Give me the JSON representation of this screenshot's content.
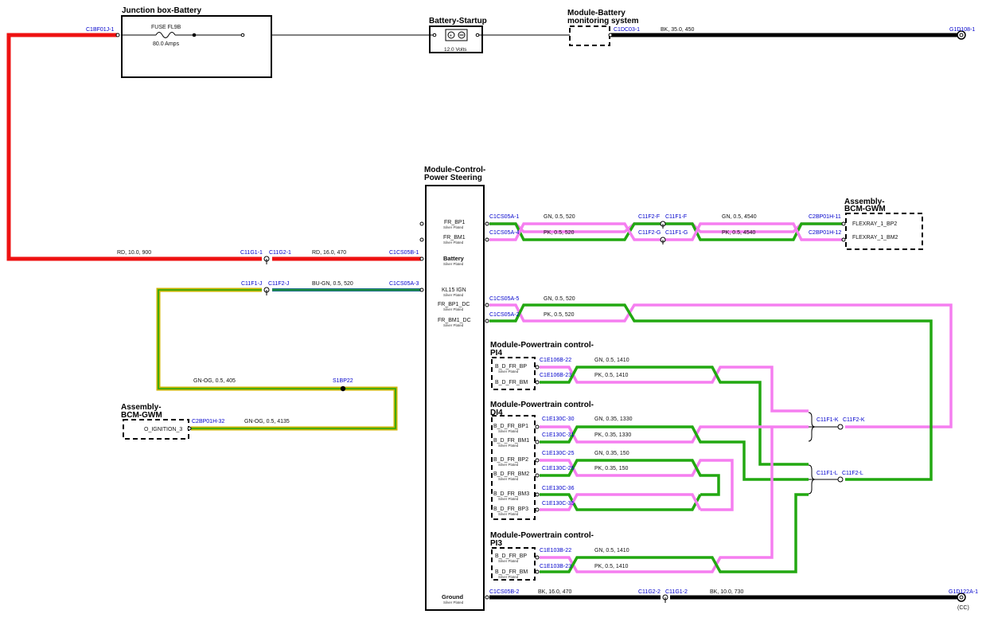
{
  "components": {
    "junction_box_battery": "Junction box-Battery",
    "fuse_label": "FUSE FL9B",
    "fuse_rating": "80.0 Amps",
    "battery_startup": "Battery-Startup",
    "battery_volts": "12.0 Volts",
    "module_battery_monitoring_1": "Module-Battery",
    "module_battery_monitoring_2": "monitoring system",
    "power_steering_1": "Module-Control-",
    "power_steering_2": "Power Steering",
    "bcm_gwm_right_1": "Assembly-",
    "bcm_gwm_right_2": "BCM-GWM",
    "bcm_gwm_left_1": "Assembly-",
    "bcm_gwm_left_2": "BCM-GWM",
    "pt_pi4_1": "Module-Powertrain control-",
    "pt_pi4_2": "PI4",
    "pt_di4_1": "Module-Powertrain control-",
    "pt_di4_2": "DI4",
    "pt_pi3_1": "Module-Powertrain control-",
    "pt_pi3_2": "PI3"
  },
  "connectors": {
    "c1bf01j_1": "C1BF01J-1",
    "c1dc03_1": "C1DC03-1",
    "g1d108_1": "G1D108-1",
    "c1cs05a_1": "C1CS05A-1",
    "c1cs05a_4": "C1CS05A-4",
    "c11f2_f": "C11F2-F",
    "c11f1_f": "C11F1-F",
    "c11f2_g": "C11F2-G",
    "c11f1_g": "C11F1-G",
    "c2bp01h_11": "C2BP01H-11",
    "c2bp01h_12": "C2BP01H-12",
    "c11g1_1": "C11G1-1",
    "c11g2_1": "C11G2-1",
    "c1cs05b_1": "C1CS05B-1",
    "c11f1_j": "C11F1-J",
    "c11f2_j": "C11F2-J",
    "c1cs05a_3": "C1CS05A-3",
    "c1cs05a_5": "C1CS05A-5",
    "c1cs05a_2": "C1CS05A-2",
    "c1e106b_22": "C1E106B-22",
    "c1e106b_23": "C1E106B-23",
    "s1bp22": "S1BP22",
    "c2bp01h_32": "C2BP01H-32",
    "c11f1_k": "C11F1-K",
    "c11f2_k": "C11F2-K",
    "c11f1_l": "C11F1-L",
    "c11f2_l": "C11F2-L",
    "c1e130c_30": "C1E130C-30",
    "c1e130c_31": "C1E130C-31",
    "c1e130c_25": "C1E130C-25",
    "c1e130c_26": "C1E130C-26",
    "c1e130c_36": "C1E130C-36",
    "c1e130c_35": "C1E130C-35",
    "c1e103b_22": "C1E103B-22",
    "c1e103b_23": "C1E103B-23",
    "c1cs05b_2": "C1CS05B-2",
    "c11g2_2": "C11G2-2",
    "c11g1_2": "C11G1-2",
    "g1d122a_1": "G1D122A-1",
    "cc": "(CC)"
  },
  "wires": {
    "bk_35_450": "BK, 35.0, 450",
    "gn_05_520_a": "GN, 0.5, 520",
    "gn_05_4540": "GN, 0.5, 4540",
    "pk_05_520_a": "PK, 0.5, 520",
    "pk_05_4540": "PK, 0.5, 4540",
    "rd_10_900": "RD, 10.0, 900",
    "rd_16_470": "RD, 16.0, 470",
    "bu_gn_05_520": "BU-GN, 0.5, 520",
    "gn_05_520_b": "GN, 0.5, 520",
    "pk_05_520_b": "PK, 0.5, 520",
    "gn_og_05_405": "GN-OG, 0.5, 405",
    "gn_og_05_4135": "GN-OG, 0.5, 4135",
    "gn_05_1410_a": "GN, 0.5, 1410",
    "pk_05_1410_a": "PK, 0.5, 1410",
    "gn_035_1330": "GN, 0.35, 1330",
    "pk_035_1330": "PK, 0.35, 1330",
    "gn_035_150": "GN, 0.35, 150",
    "pk_035_150": "PK, 0.35, 150",
    "gn_05_1410_b": "GN, 0.5, 1410",
    "pk_05_1410_b": "PK, 0.5, 1410",
    "bk_16_470": "BK, 16.0, 470",
    "bk_10_730": "BK, 10.0, 730"
  },
  "pins": {
    "ps_fr_bp1": "FR_BP1",
    "ps_fr_bm1": "FR_BM1",
    "ps_battery": "Battery",
    "ps_kl15": "KL15 IGN",
    "ps_fr_bp1_dc": "FR_BP1_DC",
    "ps_fr_bm1_dc": "FR_BM1_DC",
    "ps_ground": "Ground",
    "silver_plated": "Silver Plated",
    "flexray_bp2": "FLEXRAY_1_BP2",
    "flexray_bm2": "FLEXRAY_1_BM2",
    "o_ignition_3": "O_IGNITION_3",
    "b_d_fr_bp": "B_D_FR_BP",
    "b_d_fr_bm": "B_D_FR_BM",
    "b_d_fr_bp1": "B_D_FR_BP1",
    "b_d_fr_bm1": "B_D_FR_BM1",
    "b_d_fr_bp2": "B_D_FR_BP2",
    "b_d_fr_bm2": "B_D_FR_BM2",
    "b_d_fr_bm3": "B_D_FR_BM3",
    "b_d_fr_bp3": "B_D_FR_BP3"
  },
  "colors": {
    "red": "#ee1111",
    "black": "#000000",
    "green": "#22a811",
    "pink": "#f57ef0",
    "blue_green": "#1a6a8a",
    "yellow_green": "#c8b400",
    "connector_text": "#0000cc"
  }
}
